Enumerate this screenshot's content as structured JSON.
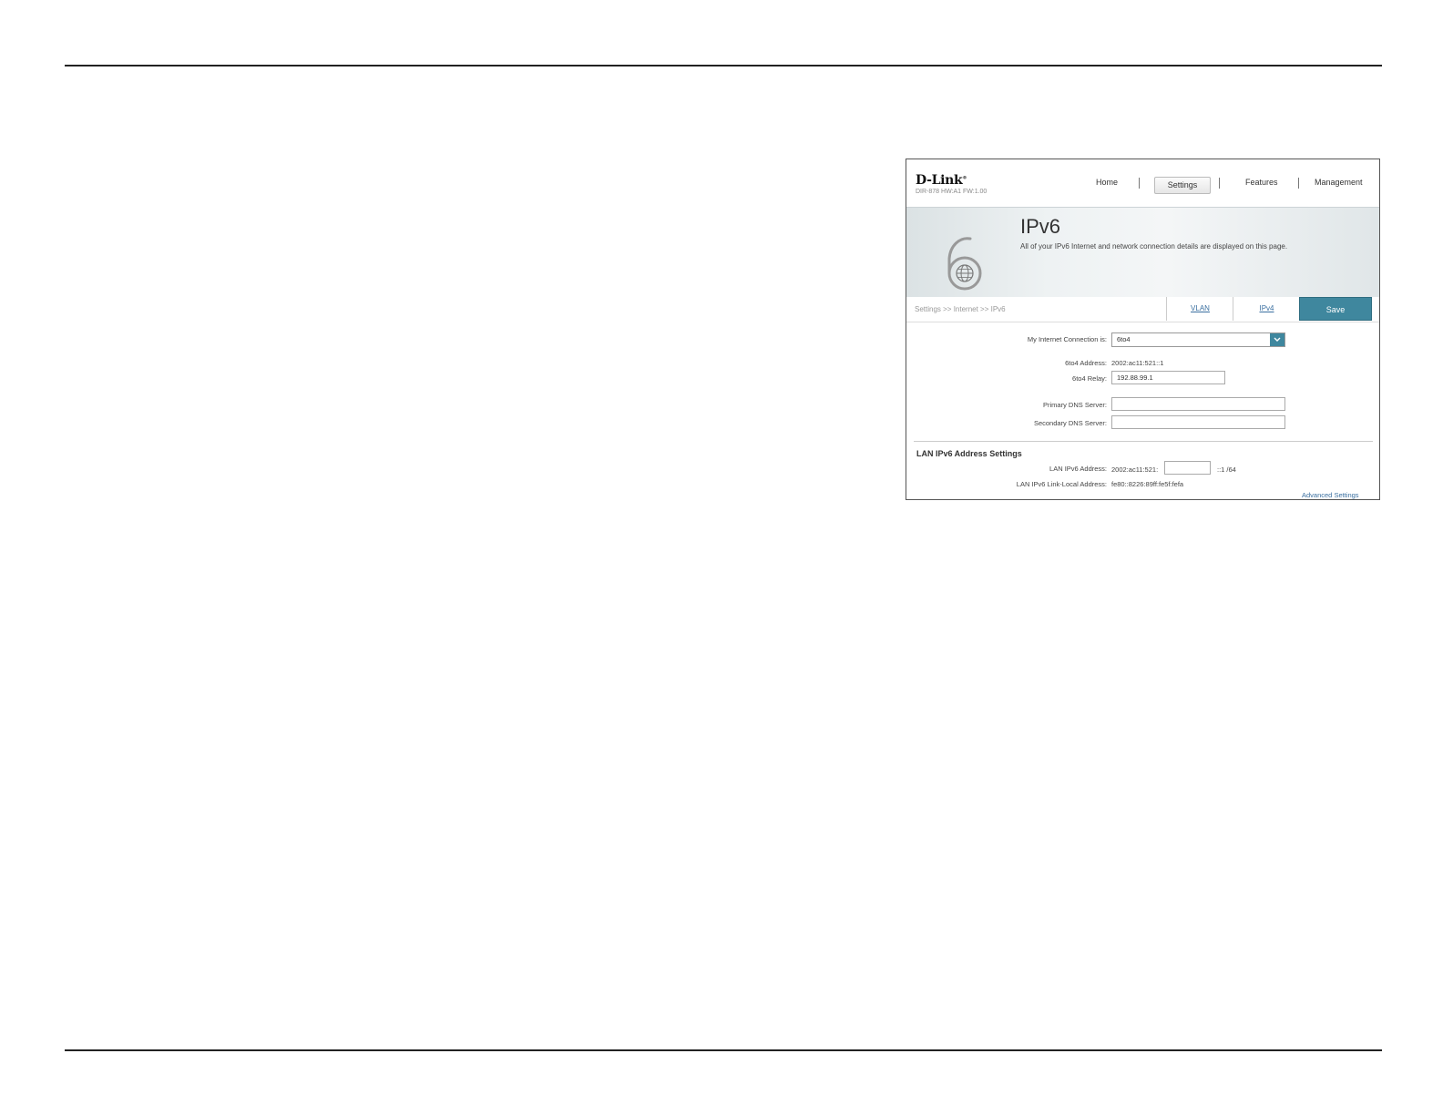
{
  "header": {
    "logo": "D-Link",
    "logo_mark": "®",
    "model": "DIR-878 HW:A1 FW:1.00",
    "nav": {
      "home": "Home",
      "settings": "Settings",
      "features": "Features",
      "management": "Management"
    }
  },
  "banner": {
    "title": "IPv6",
    "description": "All of your IPv6 Internet and network connection details are displayed on this page."
  },
  "breadcrumb": "Settings >> Internet >> IPv6",
  "tabs": {
    "vlan": "VLAN",
    "ipv4": "IPv4"
  },
  "save_label": "Save",
  "form": {
    "connection_label": "My Internet Connection is:",
    "connection_value": "6to4",
    "address_label": "6to4 Address:",
    "address_value": "2002:ac11:521::1",
    "relay_label": "6to4 Relay:",
    "relay_value": "192.88.99.1",
    "primary_dns_label": "Primary DNS Server:",
    "primary_dns_value": "",
    "secondary_dns_label": "Secondary DNS Server:",
    "secondary_dns_value": ""
  },
  "lan": {
    "section_title": "LAN IPv6 Address Settings",
    "address_label": "LAN IPv6 Address:",
    "address_prefix": "2002:ac11:521:",
    "address_input_value": "",
    "address_suffix": "::1 /64",
    "link_local_label": "LAN IPv6 Link-Local Address:",
    "link_local_value": "fe80::8226:89ff:fe5f:fefa"
  },
  "advanced_link": "Advanced Settings",
  "colors": {
    "accent": "#3f879e",
    "link": "#3a6fa0"
  },
  "icons": {
    "hero": "ipv6-globe-icon",
    "dropdown": "chevron-down-icon"
  }
}
